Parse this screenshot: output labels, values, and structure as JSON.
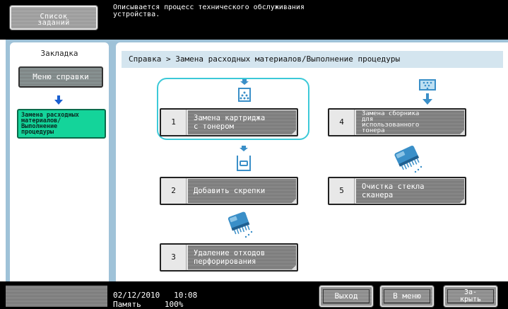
{
  "header": {
    "jobs_button_line1": "Список",
    "jobs_button_line2": "заданий",
    "message_line1": "Описывается процесс технического обслуживания",
    "message_line2": "устройства."
  },
  "sidebar": {
    "title": "Закладка",
    "help_menu_label": "Меню справки",
    "active_item_lines": [
      "Замена расходных",
      "материалов/",
      "Выполнение",
      "процедуры"
    ]
  },
  "breadcrumb": {
    "root": "Справка",
    "separator": ">",
    "current": "Замена расходных материалов/Выполнение процедуры"
  },
  "items": [
    {
      "num": "1",
      "lines": [
        "Замена картриджа",
        "с тонером"
      ],
      "icon": "toner-cartridge-icon"
    },
    {
      "num": "2",
      "lines": [
        "Добавить скрепки"
      ],
      "icon": "staples-icon"
    },
    {
      "num": "3",
      "lines": [
        "Удаление отходов",
        "перфорирования"
      ],
      "icon": "punch-waste-icon"
    },
    {
      "num": "4",
      "lines": [
        "Замена сборника",
        "для",
        "использованного",
        "тонера"
      ],
      "icon": "waste-toner-box-icon"
    },
    {
      "num": "5",
      "lines": [
        "Очистка стекла",
        "сканера"
      ],
      "icon": "scanner-glass-cleaning-icon"
    }
  ],
  "status": {
    "date": "02/12/2010",
    "time": "10:08",
    "memory_label": "Память",
    "memory_value": "100%"
  },
  "footer_buttons": {
    "exit": "Выход",
    "to_menu": "В меню",
    "close_line1": "За-",
    "close_line2": "крыть"
  },
  "colors": {
    "accent_cyan": "#3cc9d8",
    "active_green": "#14d49a",
    "frame_blue": "#9fc2d8",
    "icon_blue": "#3a8fc8"
  }
}
